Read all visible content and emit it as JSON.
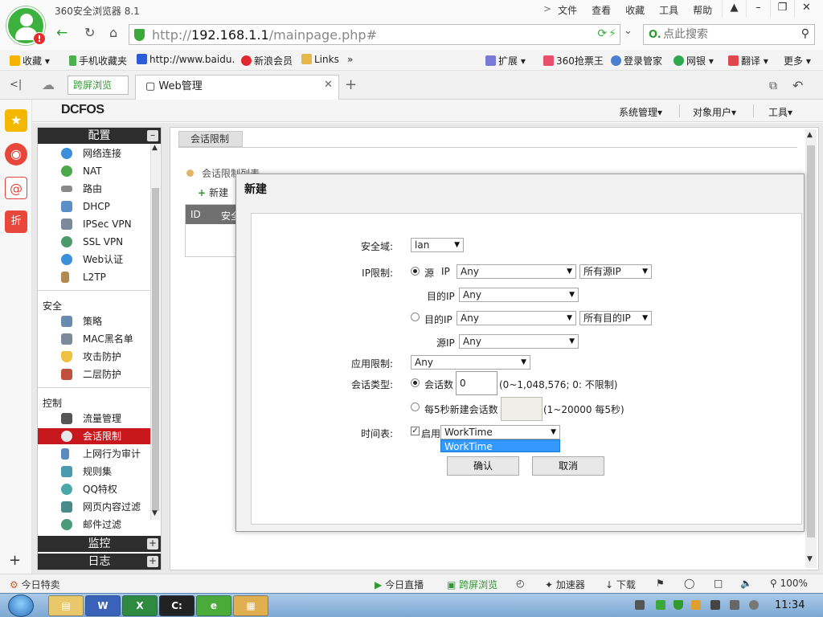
{
  "browser": {
    "title": "360安全浏览器 8.1",
    "menu": [
      "文件",
      "查看",
      "收藏",
      "工具",
      "帮助"
    ],
    "url_prefix": "http://",
    "url_host": "192.168.1.1",
    "url_path": "/mainpage.php#",
    "search_placeholder": "点此搜索",
    "bookmarks": [
      "收藏",
      "手机收藏夹",
      "http://www.baidu.",
      "新浪会员",
      "Links",
      "扩展",
      "360抢票王",
      "登录管家",
      "网银",
      "翻译",
      "更多"
    ],
    "tabs": {
      "split": "跨屏浏览",
      "active": "Web管理"
    }
  },
  "app": {
    "brand": "DCFOS",
    "header_menu": [
      "系统管理",
      "对象用户",
      "工具"
    ],
    "sidebar": {
      "config_title": "配置",
      "config_items": [
        "网络连接",
        "NAT",
        "路由",
        "DHCP",
        "IPSec VPN",
        "SSL VPN",
        "Web认证",
        "L2TP"
      ],
      "security_title": "安全",
      "security_items": [
        "策略",
        "MAC黑名单",
        "攻击防护",
        "二层防护"
      ],
      "control_title": "控制",
      "control_items": [
        "流量管理",
        "会话限制",
        "上网行为审计",
        "规则集",
        "QQ特权",
        "网页内容过滤",
        "邮件过滤"
      ],
      "monitor_title": "监控",
      "log_title": "日志"
    },
    "main": {
      "tab": "会话限制",
      "list_title": "会话限制列表",
      "new_label": "新建",
      "col_id": "ID",
      "col_sec": "安全"
    },
    "modal": {
      "title": "新建",
      "zone_label": "安全域:",
      "zone_value": "lan",
      "ip_label": "IP限制:",
      "src_radio": "源",
      "ip_word": "IP",
      "src_ip_value": "Any",
      "all_src": "所有源IP",
      "dst_ip_label": "目的IP",
      "dst_ip_value": "Any",
      "dst_radio": "目的IP",
      "dst_ip_value2": "Any",
      "all_dst": "所有目的IP",
      "src_ip_label2": "源IP",
      "src_ip_value2": "Any",
      "app_label": "应用限制:",
      "app_value": "Any",
      "session_type_label": "会话类型:",
      "session_count_label": "会话数",
      "session_count_value": "0",
      "session_count_hint": "(0~1,048,576; 0: 不限制)",
      "per5_label": "每5秒新建会话数",
      "per5_hint": "(1~20000 每5秒)",
      "schedule_label": "时间表:",
      "enable_label": "启用",
      "schedule_value": "WorkTime",
      "schedule_option": "WorkTime",
      "ok": "确认",
      "cancel": "取消"
    }
  },
  "status": {
    "left": "今日特卖",
    "live": "今日直播",
    "split": "跨屏浏览",
    "accel": "加速器",
    "download": "下载",
    "zoom": "100%"
  },
  "taskbar": {
    "clock": "11:34"
  },
  "colors": {
    "accent_green": "#3aa83a",
    "active_red": "#c8181e",
    "selection_blue": "#3399ff"
  }
}
